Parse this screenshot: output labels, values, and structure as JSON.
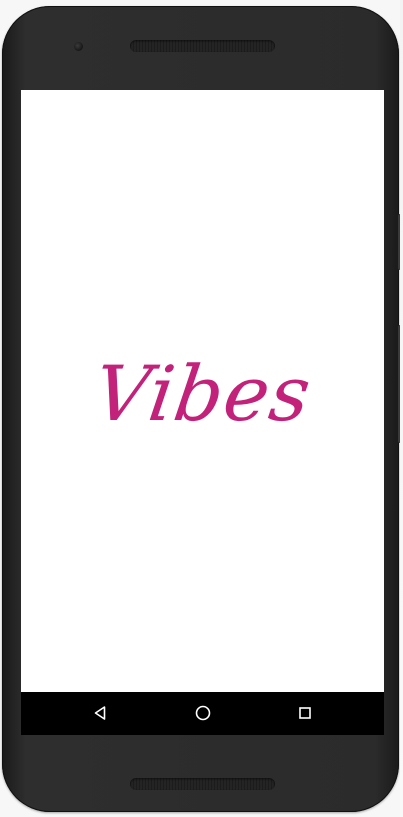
{
  "app": {
    "logo_text": "Vibes",
    "brand_color": "#c2227a"
  },
  "device": {
    "frame_color": "#2b2b2b",
    "screen_background": "#ffffff"
  },
  "nav_bar": {
    "background": "#000000",
    "icons": [
      "back-icon",
      "home-icon",
      "recents-icon"
    ]
  }
}
